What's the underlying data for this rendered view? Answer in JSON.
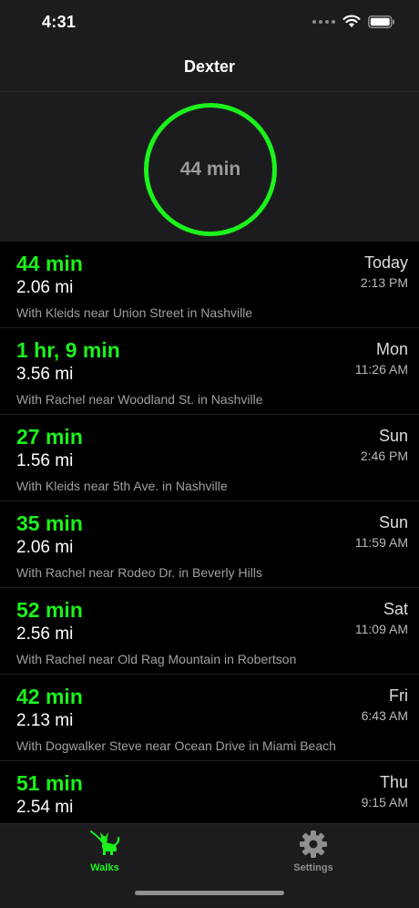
{
  "status_bar": {
    "time": "4:31"
  },
  "header": {
    "title": "Dexter"
  },
  "summary": {
    "ring_label": "44 min"
  },
  "walks": [
    {
      "duration": "44 min",
      "distance": "2.06 mi",
      "detail": "With Kleids near Union Street in Nashville",
      "day": "Today",
      "time": "2:13 PM"
    },
    {
      "duration": "1 hr, 9 min",
      "distance": "3.56 mi",
      "detail": "With Rachel near Woodland St. in Nashville",
      "day": "Mon",
      "time": "11:26 AM"
    },
    {
      "duration": "27 min",
      "distance": "1.56 mi",
      "detail": "With Kleids near 5th Ave. in Nashville",
      "day": "Sun",
      "time": "2:46 PM"
    },
    {
      "duration": "35 min",
      "distance": "2.06 mi",
      "detail": "With Rachel near Rodeo Dr. in Beverly Hills",
      "day": "Sun",
      "time": "11:59 AM"
    },
    {
      "duration": "52 min",
      "distance": "2.56 mi",
      "detail": "With Rachel near Old Rag Mountain in Robertson",
      "day": "Sat",
      "time": "11:09 AM"
    },
    {
      "duration": "42 min",
      "distance": "2.13 mi",
      "detail": "With Dogwalker Steve near Ocean Drive in Miami Beach",
      "day": "Fri",
      "time": "6:43 AM"
    },
    {
      "duration": "51 min",
      "distance": "2.54 mi",
      "detail": "",
      "day": "Thu",
      "time": "9:15 AM"
    }
  ],
  "tabs": [
    {
      "label": "Walks",
      "icon": "dog-icon",
      "active": true
    },
    {
      "label": "Settings",
      "icon": "gear-icon",
      "active": false
    }
  ],
  "colors": {
    "accent": "#1cf21c",
    "background": "#000000",
    "bar": "#1c1c1e",
    "inactive": "#8e8e93"
  }
}
